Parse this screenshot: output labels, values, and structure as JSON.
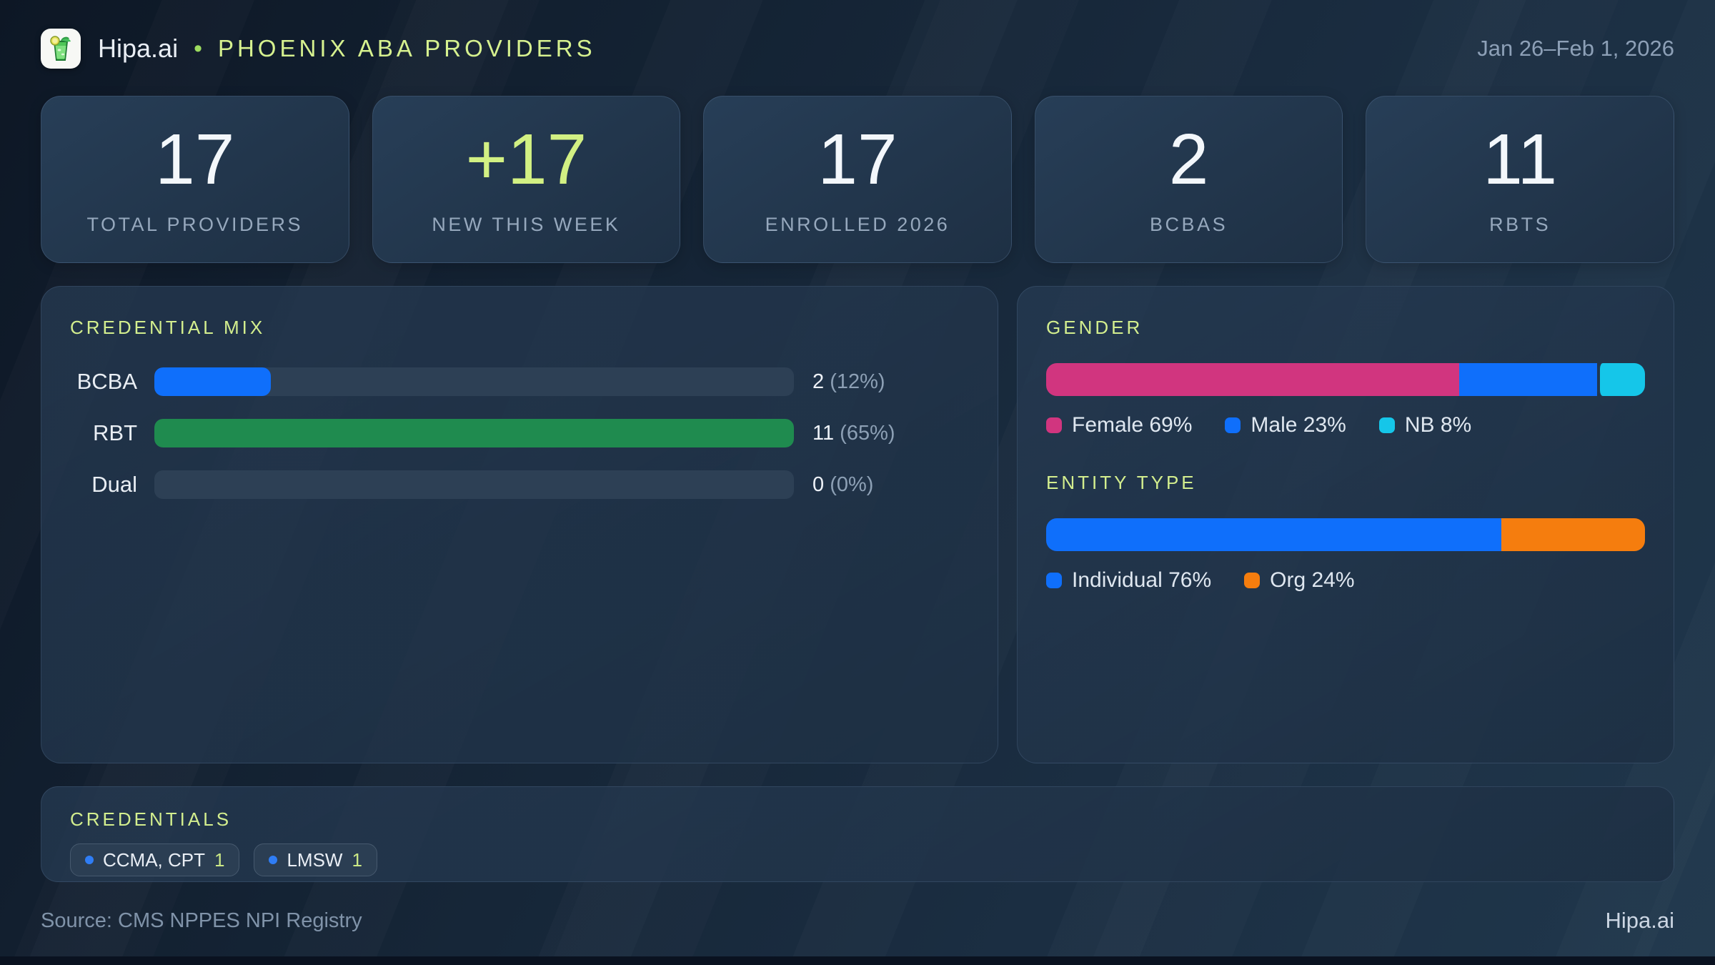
{
  "header": {
    "brand": "Hipa.ai",
    "separator": "•",
    "title": "PHOENIX ABA PROVIDERS",
    "date_range": "Jan 26–Feb 1, 2026",
    "logo_icon": "mojito-icon"
  },
  "stats": [
    {
      "value": "17",
      "label": "TOTAL PROVIDERS"
    },
    {
      "value": "+17",
      "label": "NEW THIS WEEK"
    },
    {
      "value": "17",
      "label": "ENROLLED 2026"
    },
    {
      "value": "2",
      "label": "BCBAS"
    },
    {
      "value": "11",
      "label": "RBTS"
    }
  ],
  "credential_mix": {
    "title": "CREDENTIAL MIX",
    "rows": [
      {
        "label": "BCBA",
        "count": "2",
        "pct_text": "(12%)",
        "fill_pct": 18.2,
        "color": "#0f6ffb"
      },
      {
        "label": "RBT",
        "count": "11",
        "pct_text": "(65%)",
        "fill_pct": 100,
        "color": "#1f8b4f"
      },
      {
        "label": "Dual",
        "count": "0",
        "pct_text": "(0%)",
        "fill_pct": 0,
        "color": "transparent"
      }
    ]
  },
  "gender": {
    "title": "GENDER",
    "segments": [
      {
        "name": "Female",
        "pct": 69,
        "color": "#d1357f",
        "legend": "Female 69%"
      },
      {
        "name": "Male",
        "pct": 23,
        "color": "#0f6ffb",
        "legend": "Male 23%"
      },
      {
        "name": "NB",
        "pct": 8,
        "color": "#15c6e9",
        "legend": "NB 8%"
      }
    ]
  },
  "entity_type": {
    "title": "ENTITY TYPE",
    "segments": [
      {
        "name": "Individual",
        "pct": 76,
        "color": "#0f6ffb",
        "legend": "Individual 76%"
      },
      {
        "name": "Org",
        "pct": 24,
        "color": "#f57d0e",
        "legend": "Org 24%"
      }
    ]
  },
  "credentials": {
    "title": "CREDENTIALS",
    "chips": [
      {
        "label": "CCMA, CPT",
        "count": "1"
      },
      {
        "label": "LMSW",
        "count": "1"
      }
    ]
  },
  "footer": {
    "source": "Source: CMS NPPES NPI Registry",
    "brand": "Hipa.ai"
  },
  "chart_data": [
    {
      "type": "bar",
      "title": "CREDENTIAL MIX",
      "categories": [
        "BCBA",
        "RBT",
        "Dual"
      ],
      "values": [
        2,
        11,
        0
      ],
      "percent_labels": [
        "12%",
        "65%",
        "0%"
      ],
      "xlabel": "",
      "ylabel": "",
      "xlim": [
        0,
        11
      ],
      "orientation": "horizontal",
      "grid": false,
      "colors": [
        "#0f6ffb",
        "#1f8b4f",
        "#2d4055"
      ]
    },
    {
      "type": "bar",
      "subtype": "stacked-100",
      "title": "GENDER",
      "categories": [
        "Female",
        "Male",
        "NB"
      ],
      "values": [
        69,
        23,
        8
      ],
      "unit": "%",
      "colors": [
        "#d1357f",
        "#0f6ffb",
        "#15c6e9"
      ],
      "legend_position": "below"
    },
    {
      "type": "bar",
      "subtype": "stacked-100",
      "title": "ENTITY TYPE",
      "categories": [
        "Individual",
        "Org"
      ],
      "values": [
        76,
        24
      ],
      "unit": "%",
      "colors": [
        "#0f6ffb",
        "#f57d0e"
      ],
      "legend_position": "below"
    }
  ],
  "kpi_summary": {
    "total_providers": 17,
    "new_this_week": 17,
    "enrolled_2026": 17,
    "bcbas": 2,
    "rbts": 11
  }
}
